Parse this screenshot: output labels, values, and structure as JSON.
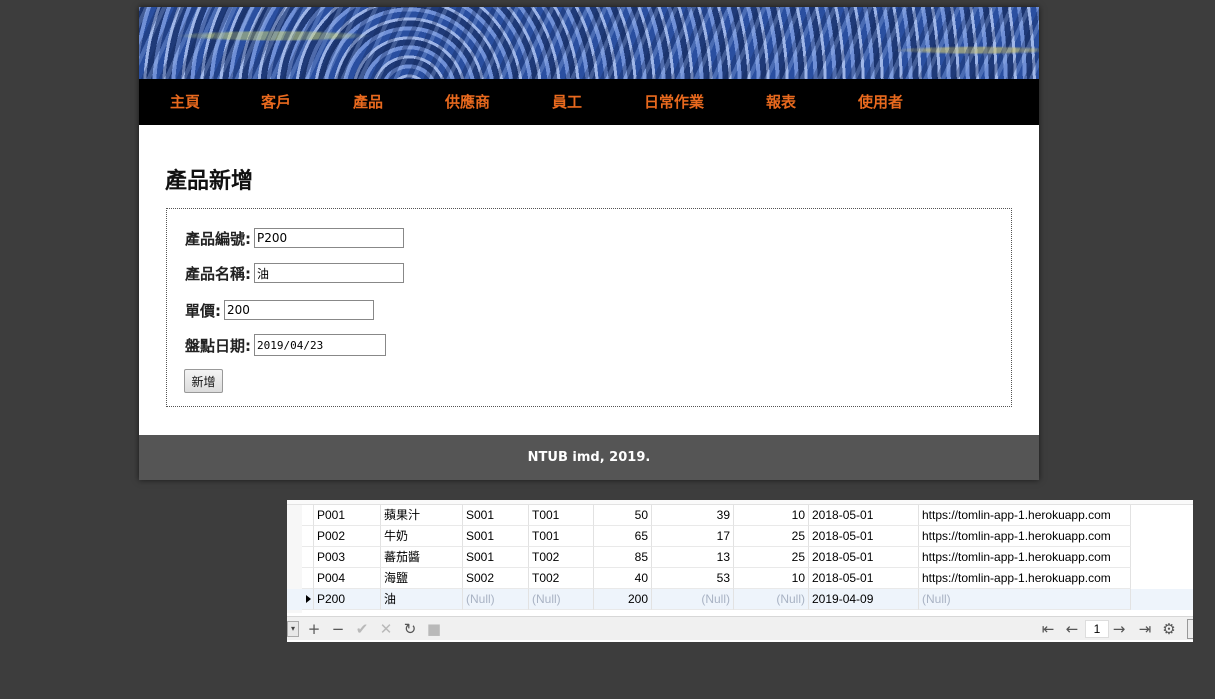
{
  "nav": {
    "items": [
      "主頁",
      "客戶",
      "產品",
      "供應商",
      "員工",
      "日常作業",
      "報表",
      "使用者"
    ]
  },
  "page": {
    "title": "產品新增"
  },
  "form": {
    "product_id_label": "產品編號:",
    "product_id_value": "P200",
    "product_name_label": "產品名稱:",
    "product_name_value": "油",
    "price_label": "單價:",
    "price_value": "200",
    "inventory_date_label": "盤點日期:",
    "inventory_date_value": "2019/04/23",
    "submit_label": "新增"
  },
  "footer": {
    "text": "NTUB imd, 2019."
  },
  "grid": {
    "rows": [
      [
        "P001",
        "蘋果汁",
        "S001",
        "T001",
        "50",
        "39",
        "10",
        "2018-05-01",
        "https://tomlin-app-1.herokuapp.com"
      ],
      [
        "P002",
        "牛奶",
        "S001",
        "T001",
        "65",
        "17",
        "25",
        "2018-05-01",
        "https://tomlin-app-1.herokuapp.com"
      ],
      [
        "P003",
        "蕃茄醬",
        "S001",
        "T002",
        "85",
        "13",
        "25",
        "2018-05-01",
        "https://tomlin-app-1.herokuapp.com"
      ],
      [
        "P004",
        "海鹽",
        "S002",
        "T002",
        "40",
        "53",
        "10",
        "2018-05-01",
        "https://tomlin-app-1.herokuapp.com"
      ],
      [
        "P200",
        "油",
        "(Null)",
        "(Null)",
        "200",
        "(Null)",
        "(Null)",
        "2019-04-09",
        "(Null)"
      ]
    ],
    "current_row": 4
  },
  "toolbar": {
    "page_number": "1",
    "icons": [
      "plus-icon",
      "minus-icon",
      "check-icon",
      "cross-icon",
      "refresh-icon",
      "stop-icon",
      "first-page-icon",
      "prev-page-icon",
      "next-page-icon",
      "last-page-icon",
      "gear-icon"
    ]
  }
}
